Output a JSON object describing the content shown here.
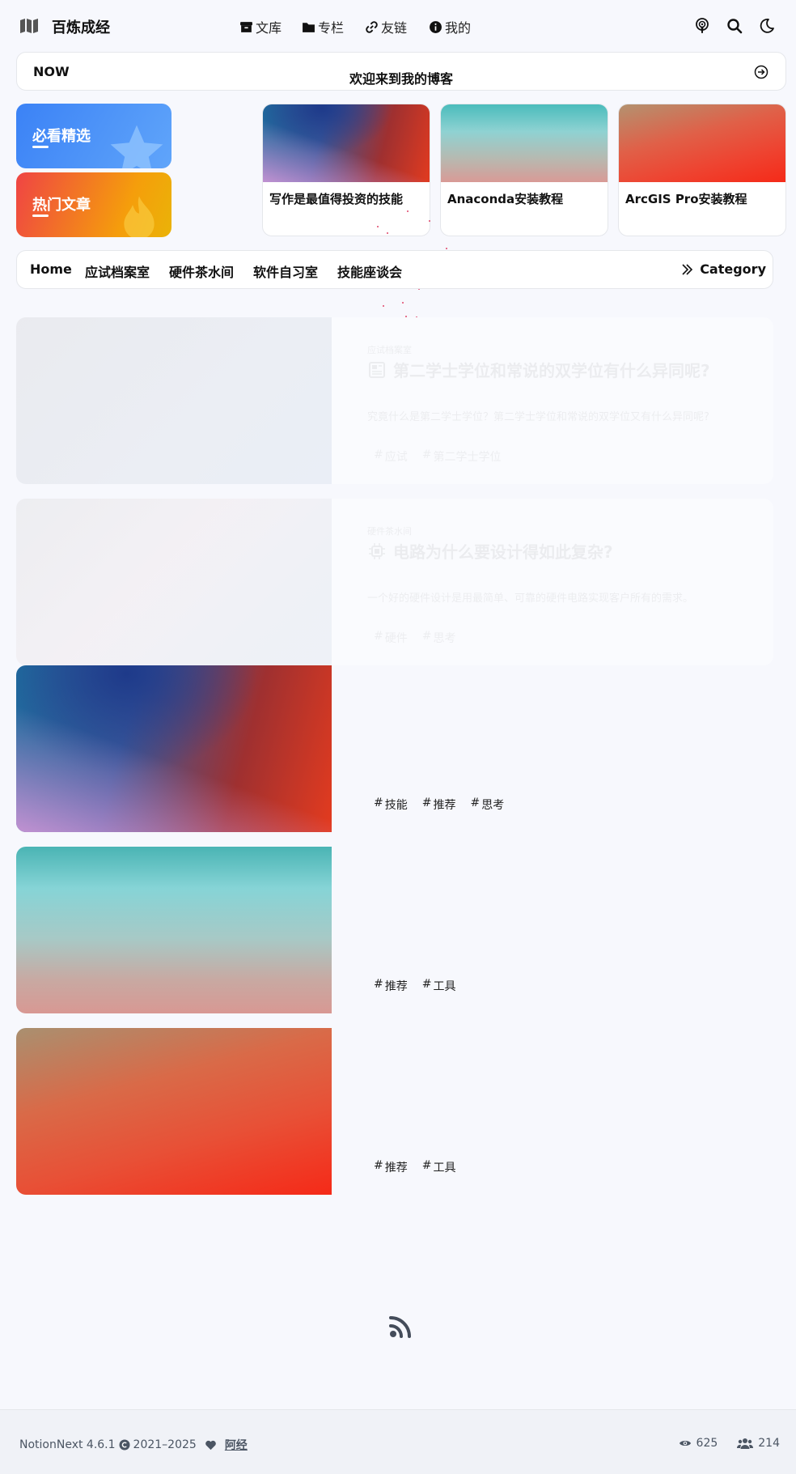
{
  "header": {
    "site_title": "百炼成经",
    "nav": [
      {
        "label": "文库",
        "icon": "archive-icon"
      },
      {
        "label": "专栏",
        "icon": "folder-icon"
      },
      {
        "label": "友链",
        "icon": "link-icon"
      },
      {
        "label": "我的",
        "icon": "info-icon"
      }
    ],
    "actions": [
      "podcast-icon",
      "search-icon",
      "moon-icon"
    ]
  },
  "notice": {
    "label": "NOW",
    "text": "欢迎来到我的博客"
  },
  "features": [
    {
      "label": "必看精选",
      "icon": "star-icon",
      "color": "#3b82f6"
    },
    {
      "label": "热门文章",
      "icon": "fire-icon",
      "color": "#f97316"
    }
  ],
  "top_posts": [
    {
      "title": "写作是最值得投资的技能"
    },
    {
      "title": "Anaconda安装教程"
    },
    {
      "title": "ArcGIS Pro安装教程"
    }
  ],
  "categories": {
    "items": [
      "Home",
      "应试档案室",
      "硬件茶水间",
      "软件自习室",
      "技能座谈会"
    ],
    "more_label": "Category"
  },
  "posts": [
    {
      "category": "应试档案室",
      "title": "第二学士学位和常说的双学位有什么异同呢?",
      "summary": "究竟什么是第二学士学位？第二学士学位和常说的双学位又有什么异同呢?",
      "tags": [
        "应试",
        "第二学士学位"
      ]
    },
    {
      "category": "硬件茶水间",
      "title": "电路为什么要设计得如此复杂?",
      "summary": "一个好的硬件设计是用最简单、可靠的硬件电路实现客户所有的需求。",
      "tags": [
        "硬件",
        "思考"
      ]
    },
    {
      "tags": [
        "技能",
        "推荐",
        "思考"
      ]
    },
    {
      "tags": [
        "推荐",
        "工具"
      ]
    },
    {
      "tags": [
        "推荐",
        "工具"
      ]
    }
  ],
  "footer": {
    "version": "NotionNext 4.6.1",
    "years": "2021–2025",
    "author": "阿经",
    "views": "625",
    "visitors": "214"
  },
  "colors": {
    "accent_blue": "#3b82f6",
    "accent_orange": "#f59e0b",
    "background": "#f7f8fd"
  }
}
